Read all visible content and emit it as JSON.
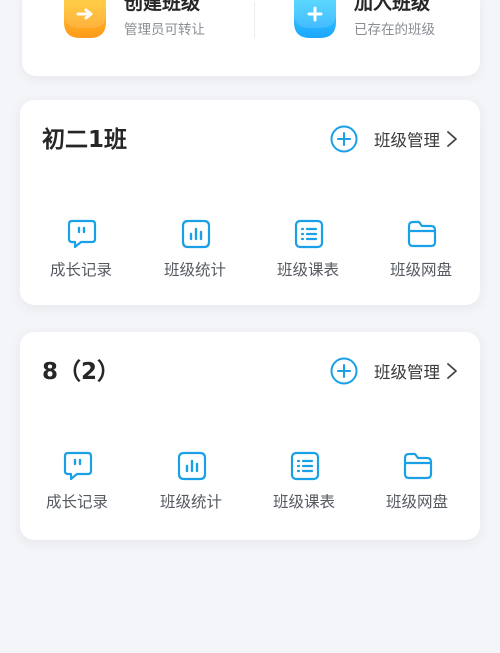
{
  "actions": {
    "create": {
      "title": "创建班级",
      "subtitle": "管理员可转让"
    },
    "join": {
      "title": "加入班级",
      "subtitle": "已存在的班级"
    }
  },
  "classes": [
    {
      "name": "初二1班",
      "manage_label": "班级管理",
      "tools": [
        "成长记录",
        "班级统计",
        "班级课表",
        "班级网盘"
      ]
    },
    {
      "name": "8（2）",
      "manage_label": "班级管理",
      "tools": [
        "成长记录",
        "班级统计",
        "班级课表",
        "班级网盘"
      ]
    }
  ],
  "colors": {
    "accent": "#1aa0e6",
    "create_gradient": [
      "#ffd52e",
      "#ff9a1a"
    ],
    "join_gradient": [
      "#4fe0ff",
      "#1aa6ff"
    ]
  },
  "icons": {
    "create": "create-class-icon",
    "join": "join-class-icon",
    "manage": "plus-circle-icon",
    "chevron": "chevron-right-icon",
    "tools": [
      "chat-bubble-icon",
      "bar-chart-icon",
      "list-schedule-icon",
      "folder-icon"
    ]
  }
}
